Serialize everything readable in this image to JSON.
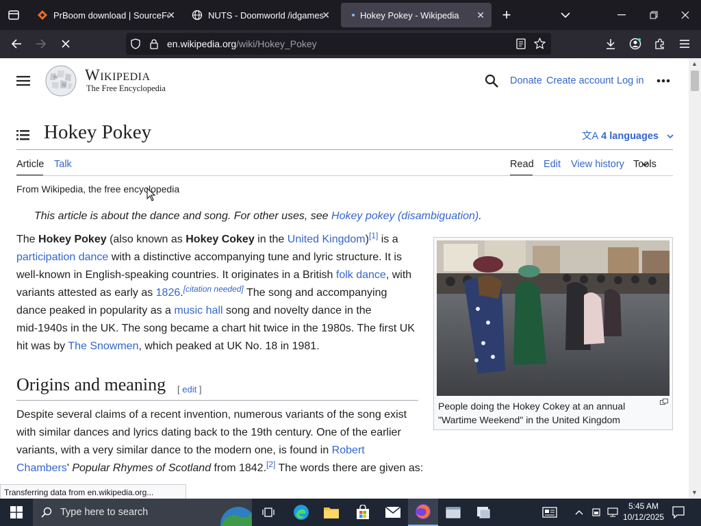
{
  "browser": {
    "tabs": [
      {
        "title": "PrBoom download | SourceForg",
        "close": "✕"
      },
      {
        "title": "NUTS - Doomworld /idgames d",
        "close": "✕"
      },
      {
        "title": "Hokey Pokey - Wikipedia",
        "close": "✕"
      }
    ],
    "new_tab": "+",
    "url_domain": "en.wikipedia.org",
    "url_prefix": "",
    "url_path": "/wiki/Hokey_Pokey",
    "status": "Transferring data from en.wikipedia.org..."
  },
  "wiki": {
    "logo_name": "Wikipedia",
    "logo_tagline": "The Free Encyclopedia",
    "donate": "Donate",
    "create_account": "Create account",
    "log_in": "Log in",
    "title": "Hokey Pokey",
    "languages": "4 languages",
    "tab_article": "Article",
    "tab_talk": "Talk",
    "tab_read": "Read",
    "tab_edit": "Edit",
    "tab_history": "View history",
    "tab_tools": "Tools",
    "from": "From Wikipedia, the free encyclopedia",
    "hatnote_text": "This article is about the dance and song. For other uses, see ",
    "hatnote_link": "Hokey pokey (disambiguation)",
    "hatnote_end": ".",
    "intro": {
      "l1a": "The ",
      "l1b": "Hokey Pokey",
      "l1c": " (also known as ",
      "l1d": "Hokey Cokey",
      "l1e": " in the ",
      "l1link": "United Kingdom",
      "l1f": ")",
      "l1ref": "[1]",
      "l1g": " is a",
      "l2link": "participation dance",
      "l2a": " with a distinctive accompanying tune and lyric structure. It is",
      "l3a": "well-known in English-speaking countries. It originates in a British ",
      "l3link": "folk dance",
      "l3b": ", with",
      "l4a": "variants attested as early as ",
      "l4link": "1826",
      "l4b": ".",
      "l4cite": "[citation needed]",
      "l4c": " The song and accompanying",
      "l5a": "dance peaked in popularity as a ",
      "l5link": "music hall",
      "l5b": " song and novelty dance in the",
      "l6": "mid-1940s in the UK. The song became a chart hit twice in the 1980s. The first UK",
      "l7a": "hit was by ",
      "l7link": "The Snowmen",
      "l7b": ", which peaked at UK No. 18 in 1981."
    },
    "caption_1": "People doing the Hokey Cokey at an annual",
    "caption_2": "\"Wartime Weekend\" in the United Kingdom",
    "section_title": "Origins and meaning",
    "edit_open": "[ ",
    "edit_label": "edit",
    "edit_close": " ]",
    "origins": {
      "l1": "Despite several claims of a recent invention, numerous variants of the song exist",
      "l2": "with similar dances and lyrics dating back to the 19th century. One of the earlier",
      "l3a": "variants, with a very similar dance to the modern one, is found in ",
      "l3link": "Robert",
      "l4link": "Chambers",
      "l4a": "' ",
      "l4i": "Popular Rhymes of Scotland",
      "l4b": " from 1842.",
      "l4ref": "[2]",
      "l4c": " The words there are given as:"
    }
  },
  "taskbar": {
    "search_placeholder": "Type here to search",
    "time": "5:45 AM",
    "date": "10/12/2025"
  }
}
